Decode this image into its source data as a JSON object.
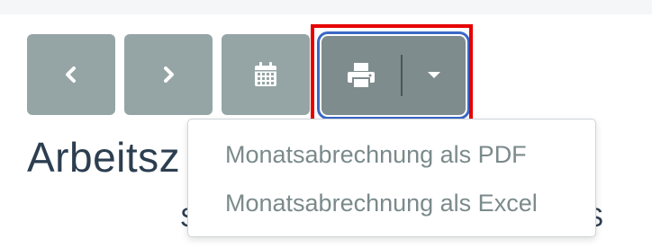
{
  "toolbar": {
    "prev_icon": "chevron-left-icon",
    "next_icon": "chevron-right-icon",
    "calendar_icon": "calendar-icon",
    "print_icon": "print-icon",
    "caret_icon": "caret-down-icon"
  },
  "colors": {
    "button_bg": "#95a5a6",
    "active_button_bg": "#7f8c8d",
    "focus_ring": "#3b68c6",
    "highlight_frame": "#e60000",
    "heading_text": "#2c3e50",
    "menu_text": "#7b8a8b"
  },
  "page": {
    "heading_visible": "Arbeitsz",
    "subtext_left": "S",
    "subtext_right": "S"
  },
  "print_menu": {
    "items": [
      {
        "label": "Monatsabrechnung als PDF"
      },
      {
        "label": "Monatsabrechnung als Excel"
      }
    ]
  }
}
